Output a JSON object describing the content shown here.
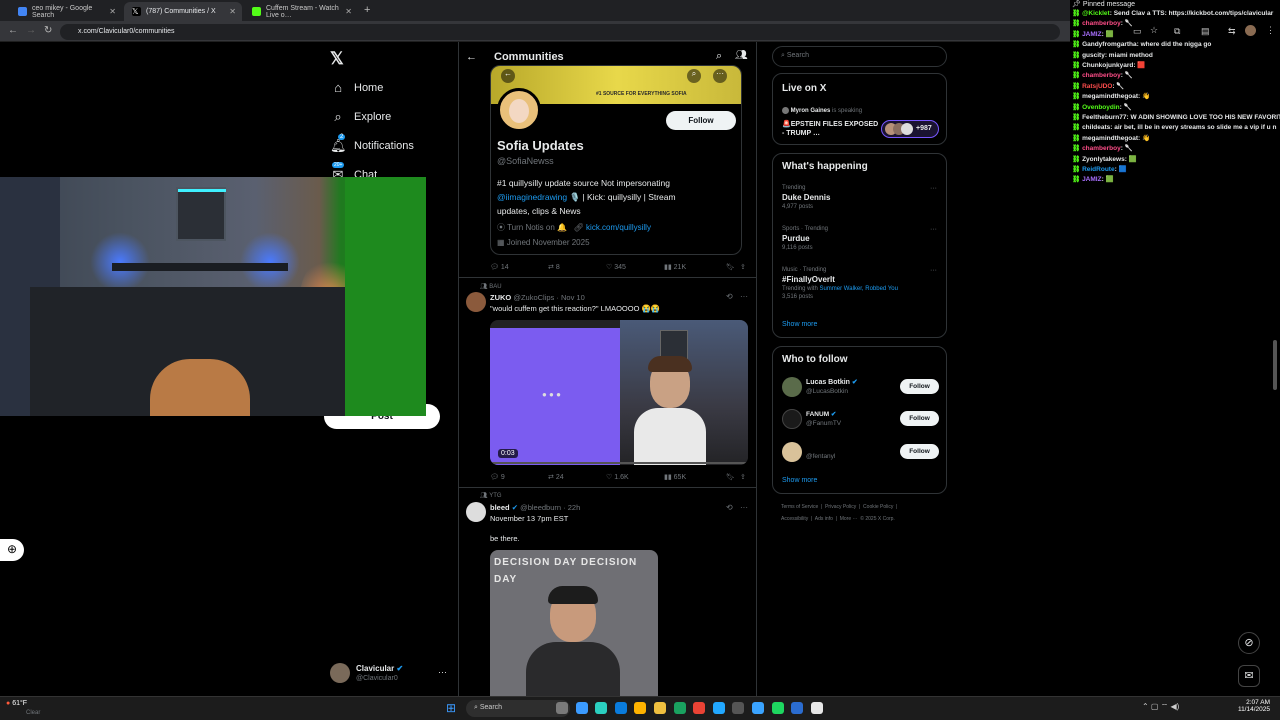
{
  "browser": {
    "tabs": [
      {
        "label": "ceo mikey - Google Search",
        "active": false
      },
      {
        "label": "(787) Communities / X",
        "active": true
      },
      {
        "label": "Cuffem Stream - Watch Live o…",
        "active": false
      }
    ],
    "url": "x.com/Clavicular0/communities"
  },
  "nav": {
    "home": "Home",
    "explore": "Explore",
    "notifications": "Notifications",
    "notifications_badge": "2",
    "chat": "Chat",
    "chat_badge": "20+",
    "post_button": "Post",
    "account_name": "Clavicular",
    "account_handle": "@Clavicular0"
  },
  "header": {
    "title": "Communities"
  },
  "profile_card": {
    "name": "Sofia Updates",
    "handle": "@SofiaNewss",
    "follow": "Follow",
    "bio_line1": "#1 quillysilly update source Not impersonating",
    "bio_mention": "@iimaginedrawing",
    "bio_after_mention": "🎙️ | Kick: quillysilly | Stream",
    "bio_line3": "updates, clips & News",
    "notis": "Turn Notis on 🔔",
    "link": "kick.com/quillysilly",
    "joined": "Joined November 2025",
    "banner_text": "#1 SOURCE FOR EVERYTHING SOFIA"
  },
  "post1_actions": {
    "replies": "14",
    "reposts": "8",
    "likes": "345",
    "views": "21K"
  },
  "post2": {
    "community": "BAU",
    "name": "ZUKO",
    "handle": "@ZukoClips",
    "date": "· Nov 10",
    "text": "\"would cuffem get this reaction?\" LMAOOOO 😭😭",
    "duration": "0:03",
    "replies": "9",
    "reposts": "24",
    "likes": "1.6K",
    "views": "65K"
  },
  "post3": {
    "community": "YTG",
    "name": "bleed",
    "handle": "@bleedburn",
    "date": "· 22h",
    "line1": "November 13 7pm EST",
    "line2": "be there.",
    "image_text": "DECISION DAY"
  },
  "search": {
    "placeholder": "Search"
  },
  "live": {
    "title": "Live on X",
    "host": "Myron Gaines",
    "host_suffix": "is speaking",
    "topic": "🚨EPSTEIN FILES EXPOSED - TRUMP …",
    "count": "+987"
  },
  "happening": {
    "title": "What's happening",
    "trends": [
      {
        "meta": "Trending",
        "title": "Duke Dennis",
        "extra": "4,977 posts"
      },
      {
        "meta": "Sports · Trending",
        "title": "Purdue",
        "extra": "9,116 posts"
      },
      {
        "meta": "Music · Trending",
        "title": "#FinallyOverIt",
        "with_label": "Trending with",
        "with_links": "Summer Walker, Robbed You",
        "extra": "3,516 posts"
      }
    ],
    "show_more": "Show more"
  },
  "who_to_follow": {
    "title": "Who to follow",
    "accounts": [
      {
        "name": "Lucas Botkin",
        "handle": "@LucasBotkin",
        "follow": "Follow"
      },
      {
        "name": "FANUM",
        "handle": "@FanumTV",
        "follow": "Follow"
      },
      {
        "name": "",
        "handle": "@fentanyl",
        "follow": "Follow"
      }
    ],
    "show_more": "Show more"
  },
  "footer": {
    "line1": "Terms of Service  |  Privacy Policy  |  Cookie Policy  |",
    "line2": "Accessibility  |  Ads info  |  More ···  © 2025 X Corp."
  },
  "chat": {
    "pinned": "Pinned message",
    "lines": [
      {
        "user": "@Kicklet",
        "msg": ": Send Clav a TTS: https://kickbot.com/tips/clavicular",
        "color": "#53fc18"
      },
      {
        "user": "chamberboy",
        "msg": ": 🥄",
        "color": "#ff4d88"
      },
      {
        "user": "JAMIZ",
        "msg": ": 🟩",
        "color": "#a970ff"
      },
      {
        "user": "Gandyfromgartha",
        "msg": ": where did the nigga go",
        "color": "#e7e9ea"
      },
      {
        "user": "guscity",
        "msg": ": miami method",
        "color": "#e7e9ea"
      },
      {
        "user": "Chunkojunkyard",
        "msg": ": 🟥",
        "color": "#e7e9ea"
      },
      {
        "user": "chamberboy",
        "msg": ": 🥄",
        "color": "#ff4d88"
      },
      {
        "user": "RatsjUDO",
        "msg": ": 🥄",
        "color": "#ff4d4d"
      },
      {
        "user": "megamindthegoat",
        "msg": ": 👋",
        "color": "#e7e9ea"
      },
      {
        "user": "Ovenboydin",
        "msg": ": 🥄",
        "color": "#53fc18"
      },
      {
        "user": "Feeltheburn77",
        "msg": ": W ADIN SHOWING LOVE TOO HIS NEW FAVORIT",
        "color": "#e7e9ea"
      },
      {
        "user": "childeats",
        "msg": ": air bet, ill be in every streams so slide me a vip if u n",
        "color": "#e7e9ea"
      },
      {
        "user": "megamindthegoat",
        "msg": ": 👋",
        "color": "#e7e9ea"
      },
      {
        "user": "chamberboy",
        "msg": ": 🥄",
        "color": "#ff4d88"
      },
      {
        "user": "Zyonlytakews",
        "msg": ": 🟩",
        "color": "#e7e9ea"
      },
      {
        "user": "ReidRoute",
        "msg": ": 🟦",
        "color": "#1d9bf0"
      },
      {
        "user": "JAMIZ",
        "msg": ": 🟩",
        "color": "#a970ff"
      }
    ]
  },
  "taskbar": {
    "weather_temp": "61°F",
    "weather_desc": "Clear",
    "search": "Search",
    "time": "2:07 AM",
    "date": "11/14/2025"
  }
}
